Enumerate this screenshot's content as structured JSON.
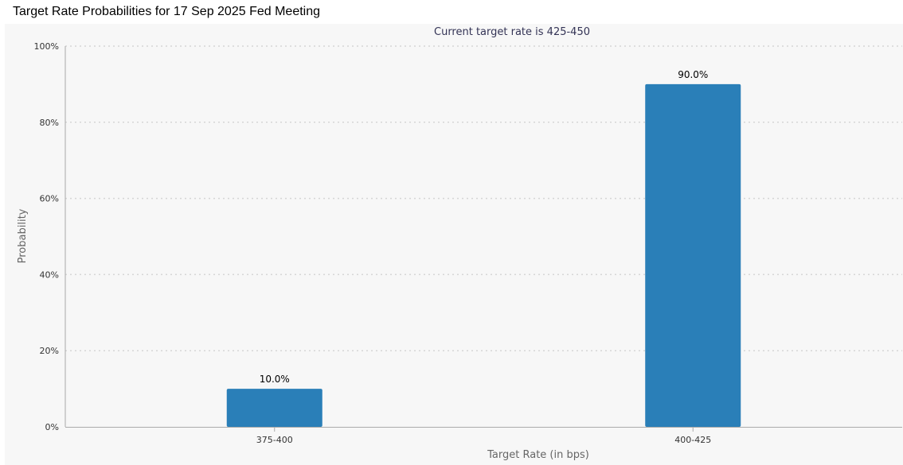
{
  "page": {
    "title": "Target Rate Probabilities for 17 Sep 2025 Fed Meeting"
  },
  "chart_data": {
    "type": "bar",
    "title": "",
    "subtitle": "Current target rate is 425-450",
    "xlabel": "Target Rate (in bps)",
    "ylabel": "Probability",
    "categories": [
      "375-400",
      "400-425"
    ],
    "values": [
      10.0,
      90.0
    ],
    "data_labels": [
      "10.0%",
      "90.0%"
    ],
    "ylim": [
      0,
      100
    ],
    "y_ticks": [
      0,
      20,
      40,
      60,
      80,
      100
    ],
    "y_tick_labels": [
      "0%",
      "20%",
      "40%",
      "60%",
      "80%",
      "100%"
    ],
    "grid": true,
    "legend": "none",
    "colors": {
      "bar": "#2a7fb8",
      "panel_background": "#f7f7f7",
      "subtitle": "#333355",
      "axis_text": "#333333",
      "axis_title": "#666666",
      "gridline": "#d6d6d6",
      "axis_line": "#aaaaaa"
    }
  }
}
